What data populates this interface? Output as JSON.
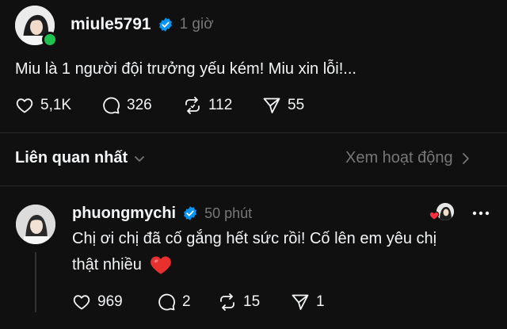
{
  "post": {
    "username": "miule5791",
    "time": "1 giờ",
    "text": "Miu là 1 người đội trưởng yếu kém! Miu xin lỗi!...",
    "likes": "5,1K",
    "comments": "326",
    "reposts": "112",
    "shares": "55"
  },
  "sort": {
    "label": "Liên quan nhất",
    "activity_label": "Xem hoạt động"
  },
  "reply": {
    "username": "phuongmychi",
    "time": "50 phút",
    "text_line1": "Chị ơi chị đã cố gắng hết sức rồi! Cố lên em yêu chị",
    "text_line2": "thật nhiều",
    "likes": "969",
    "comments": "2",
    "reposts": "15",
    "shares": "1"
  },
  "colors": {
    "background": "#101010",
    "text": "#f3f5f7",
    "muted": "#777777",
    "verified": "#0095f6",
    "online": "#1fc24f",
    "heart": "#ff3040"
  },
  "icons": [
    "heart-icon",
    "comment-icon",
    "repost-icon",
    "share-icon",
    "verified-icon",
    "chevron-down-icon",
    "chevron-right-icon",
    "more-icon"
  ]
}
